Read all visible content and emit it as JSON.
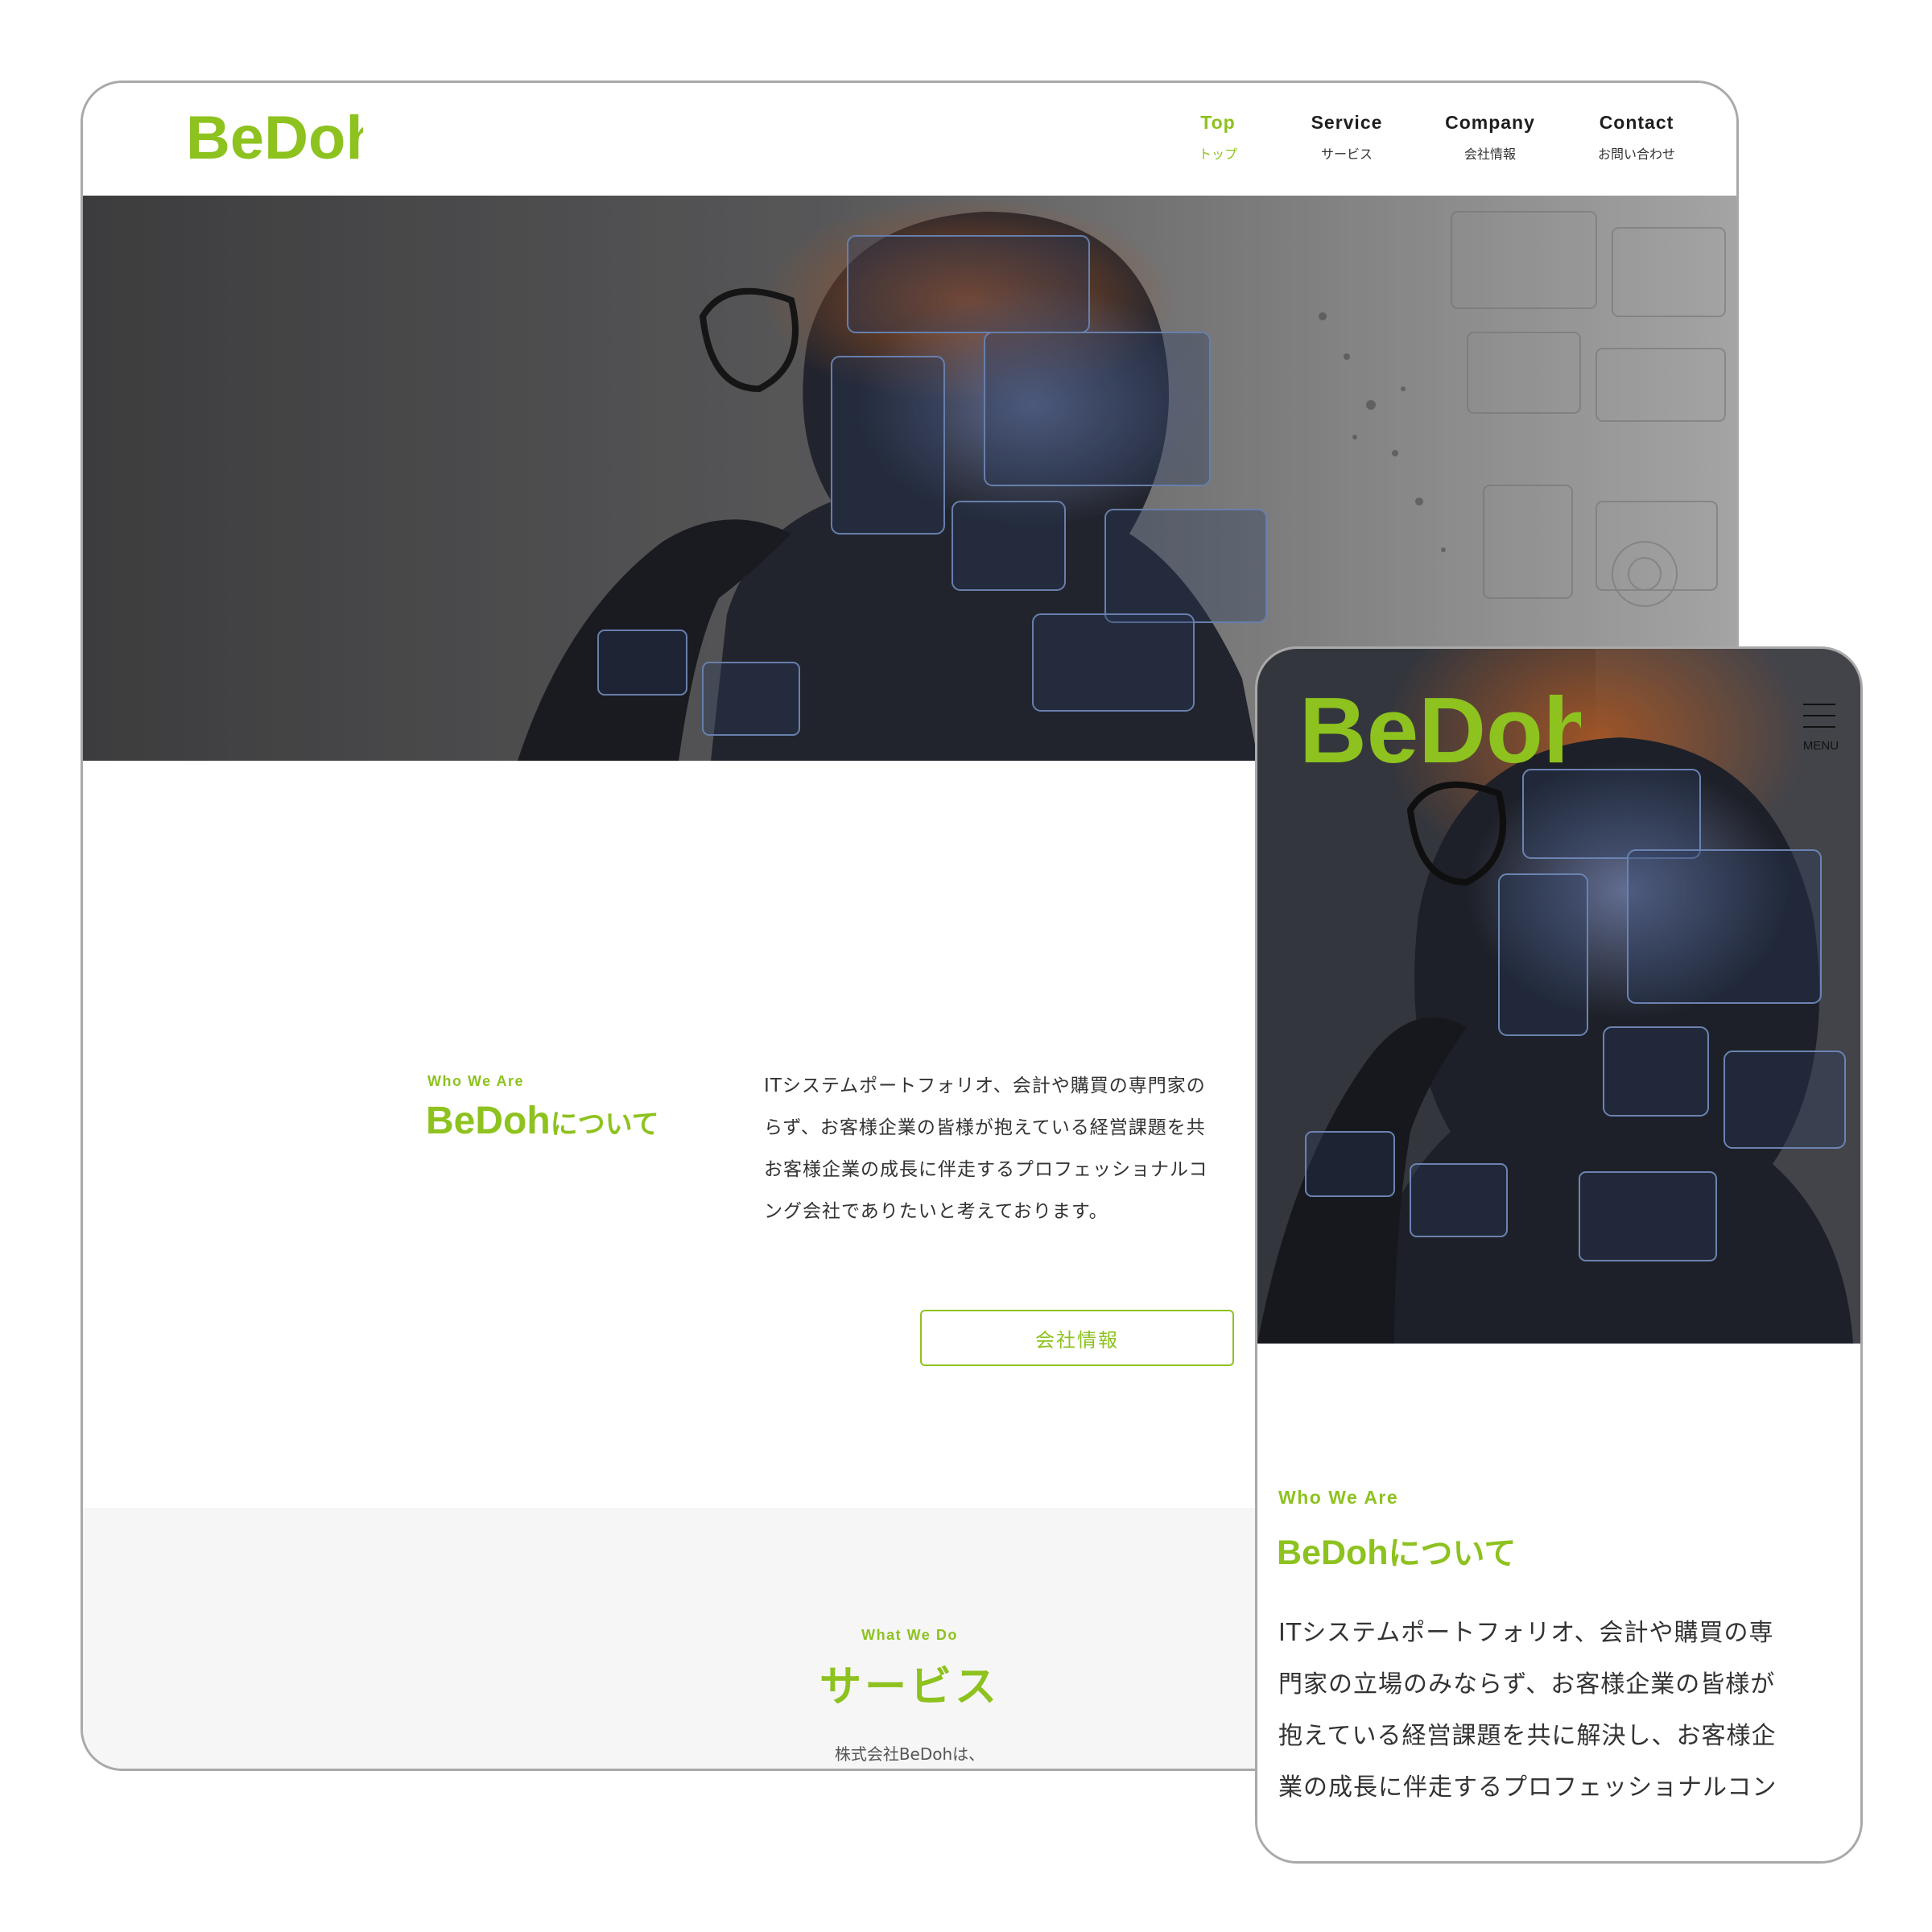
{
  "brand": {
    "logo_text": "BeDoh",
    "accent_color": "#8dc21f"
  },
  "desktop": {
    "nav": [
      {
        "en": "Top",
        "ja": "トップ",
        "active": true
      },
      {
        "en": "Service",
        "ja": "サービス",
        "active": false
      },
      {
        "en": "Company",
        "ja": "会社情報",
        "active": false
      },
      {
        "en": "Contact",
        "ja": "お問い合わせ",
        "active": false
      }
    ],
    "hero_image": "person-with-digital-data-overlay",
    "about": {
      "eyebrow": "Who We Are",
      "title_main": "BeDoh",
      "title_suffix": "について",
      "body_lines": [
        "ITシステムポートフォリオ、会計や購買の専門家の",
        "らず、お客様企業の皆様が抱えている経営課題を共",
        "お客様企業の成長に伴走するプロフェッショナルコ",
        "ング会社でありたいと考えております。"
      ],
      "button_label": "会社情報"
    },
    "service": {
      "eyebrow": "What We Do",
      "title": "サービス",
      "lead": "株式会社BeDohは、"
    }
  },
  "mobile": {
    "menu_label": "MENU",
    "about": {
      "eyebrow": "Who We Are",
      "title_main": "BeDoh",
      "title_suffix": "について",
      "body_lines": [
        "ITシステムポートフォリオ、会計や購買の専",
        "門家の立場のみならず、お客様企業の皆様が",
        "抱えている経営課題を共に解決し、お客様企",
        "業の成長に伴走するプロフェッショナルコン"
      ]
    }
  }
}
